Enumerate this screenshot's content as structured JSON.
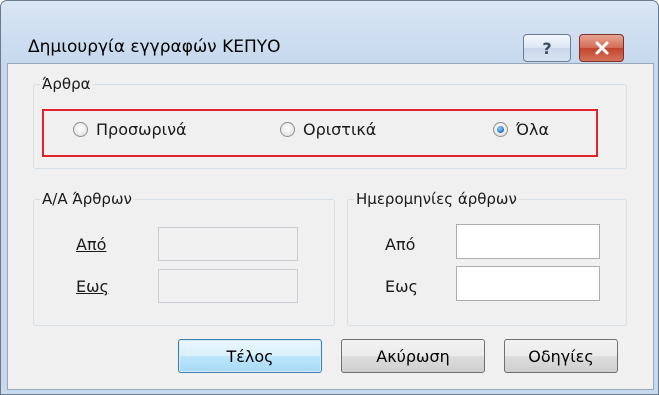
{
  "window": {
    "title": "Δημιουργία εγγραφών ΚΕΠΥΟ",
    "help_label": "?",
    "close_label": "✕"
  },
  "arthra_group": {
    "legend": "Άρθρα",
    "options": [
      {
        "label": "Προσωρινά",
        "checked": false
      },
      {
        "label": "Οριστικά",
        "checked": false
      },
      {
        "label": "Όλα",
        "checked": true
      }
    ]
  },
  "aa_group": {
    "legend": "Α/Α Άρθρων",
    "from_label": "Από",
    "to_label": "Εως",
    "from_value": "",
    "to_value": ""
  },
  "dates_group": {
    "legend": "Ημερομηνίες άρθρων",
    "from_label": "Από",
    "to_label": "Εως",
    "from_value": "",
    "to_value": ""
  },
  "buttons": {
    "finish": "Τέλος",
    "cancel": "Ακύρωση",
    "help": "Οδηγίες"
  },
  "colors": {
    "highlight_border": "#e0222a",
    "default_button_border": "#3c7fb1",
    "close_button": "#c1452c"
  }
}
